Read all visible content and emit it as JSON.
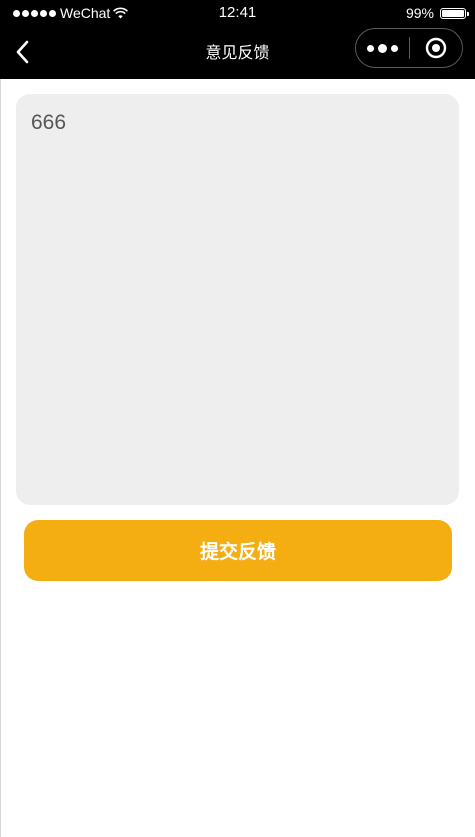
{
  "status_bar": {
    "carrier": "WeChat",
    "time": "12:41",
    "battery_percent": "99%",
    "battery_level": 0.99
  },
  "nav_bar": {
    "title": "意见反馈",
    "back_icon": "chevron-left-icon",
    "more_icon": "more-dots-icon",
    "close_icon": "target-circle-icon"
  },
  "feedback": {
    "value": "666",
    "background_color": "#eeeeee"
  },
  "submit": {
    "label": "提交反馈",
    "color": "#f4ae12"
  }
}
